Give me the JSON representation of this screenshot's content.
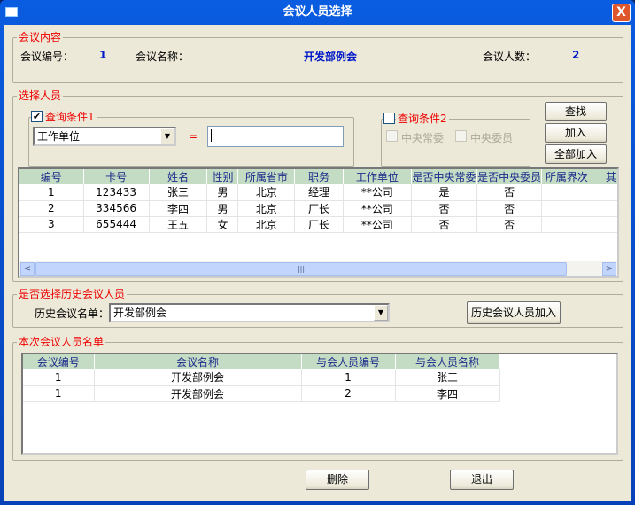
{
  "window": {
    "title": "会议人员选择",
    "close": "X"
  },
  "meeting_info": {
    "legend": "会议内容",
    "id_label": "会议编号：",
    "id_value": "1",
    "name_label": "会议名称：",
    "name_value": "开发部例会",
    "count_label": "会议人数：",
    "count_value": "2"
  },
  "select": {
    "legend": "选择人员",
    "cond1": {
      "label": "查询条件1",
      "checked": true,
      "field": "工作单位",
      "operator": "=",
      "value": ""
    },
    "cond2": {
      "label": "查询条件2",
      "checked": false,
      "opt1": "中央常委",
      "opt2": "中央委员"
    },
    "buttons": {
      "find": "查找",
      "add": "加入",
      "add_all": "全部加入"
    },
    "table": {
      "columns": [
        "编号",
        "卡号",
        "姓名",
        "性别",
        "所属省市",
        "职务",
        "工作单位",
        "是否中央常委",
        "是否中央委员",
        "所属界次",
        "其"
      ],
      "rows": [
        [
          "1",
          "123433",
          "张三",
          "男",
          "北京",
          "经理",
          "**公司",
          "是",
          "否",
          "",
          ""
        ],
        [
          "2",
          "334566",
          "李四",
          "男",
          "北京",
          "厂长",
          "**公司",
          "否",
          "否",
          "",
          ""
        ],
        [
          "3",
          "655444",
          "王五",
          "女",
          "北京",
          "厂长",
          "**公司",
          "否",
          "否",
          "",
          ""
        ]
      ]
    }
  },
  "history": {
    "legend": "是否选择历史会议人员",
    "label": "历史会议名单：",
    "selected": "开发部例会",
    "button": "历史会议人员加入"
  },
  "attendees": {
    "legend": "本次会议人员名单",
    "columns": [
      "会议编号",
      "会议名称",
      "与会人员编号",
      "与会人员名称"
    ],
    "rows": [
      [
        "1",
        "开发部例会",
        "1",
        "张三"
      ],
      [
        "1",
        "开发部例会",
        "2",
        "李四"
      ]
    ]
  },
  "footer": {
    "delete": "删除",
    "exit": "退出"
  }
}
